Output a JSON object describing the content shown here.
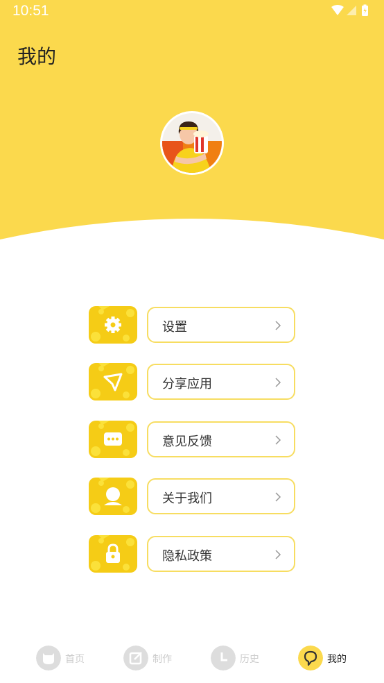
{
  "status_bar": {
    "time": "10:51"
  },
  "header": {
    "title": "我的"
  },
  "menu": {
    "items": [
      {
        "label": "设置",
        "icon": "gear-icon"
      },
      {
        "label": "分享应用",
        "icon": "send-icon"
      },
      {
        "label": "意见反馈",
        "icon": "chat-bubble-icon"
      },
      {
        "label": "关于我们",
        "icon": "person-icon"
      },
      {
        "label": "隐私政策",
        "icon": "lock-icon"
      }
    ]
  },
  "tab_bar": {
    "tabs": [
      {
        "label": "首页",
        "icon": "cat-face-icon",
        "active": false
      },
      {
        "label": "制作",
        "icon": "edit-icon",
        "active": false
      },
      {
        "label": "历史",
        "icon": "clock-icon",
        "active": false
      },
      {
        "label": "我的",
        "icon": "profile-icon",
        "active": true
      }
    ]
  },
  "colors": {
    "accent": "#fbd94d",
    "card_border": "#f7dd61",
    "tile": "#f5cc16",
    "inactive": "#cccccc"
  }
}
